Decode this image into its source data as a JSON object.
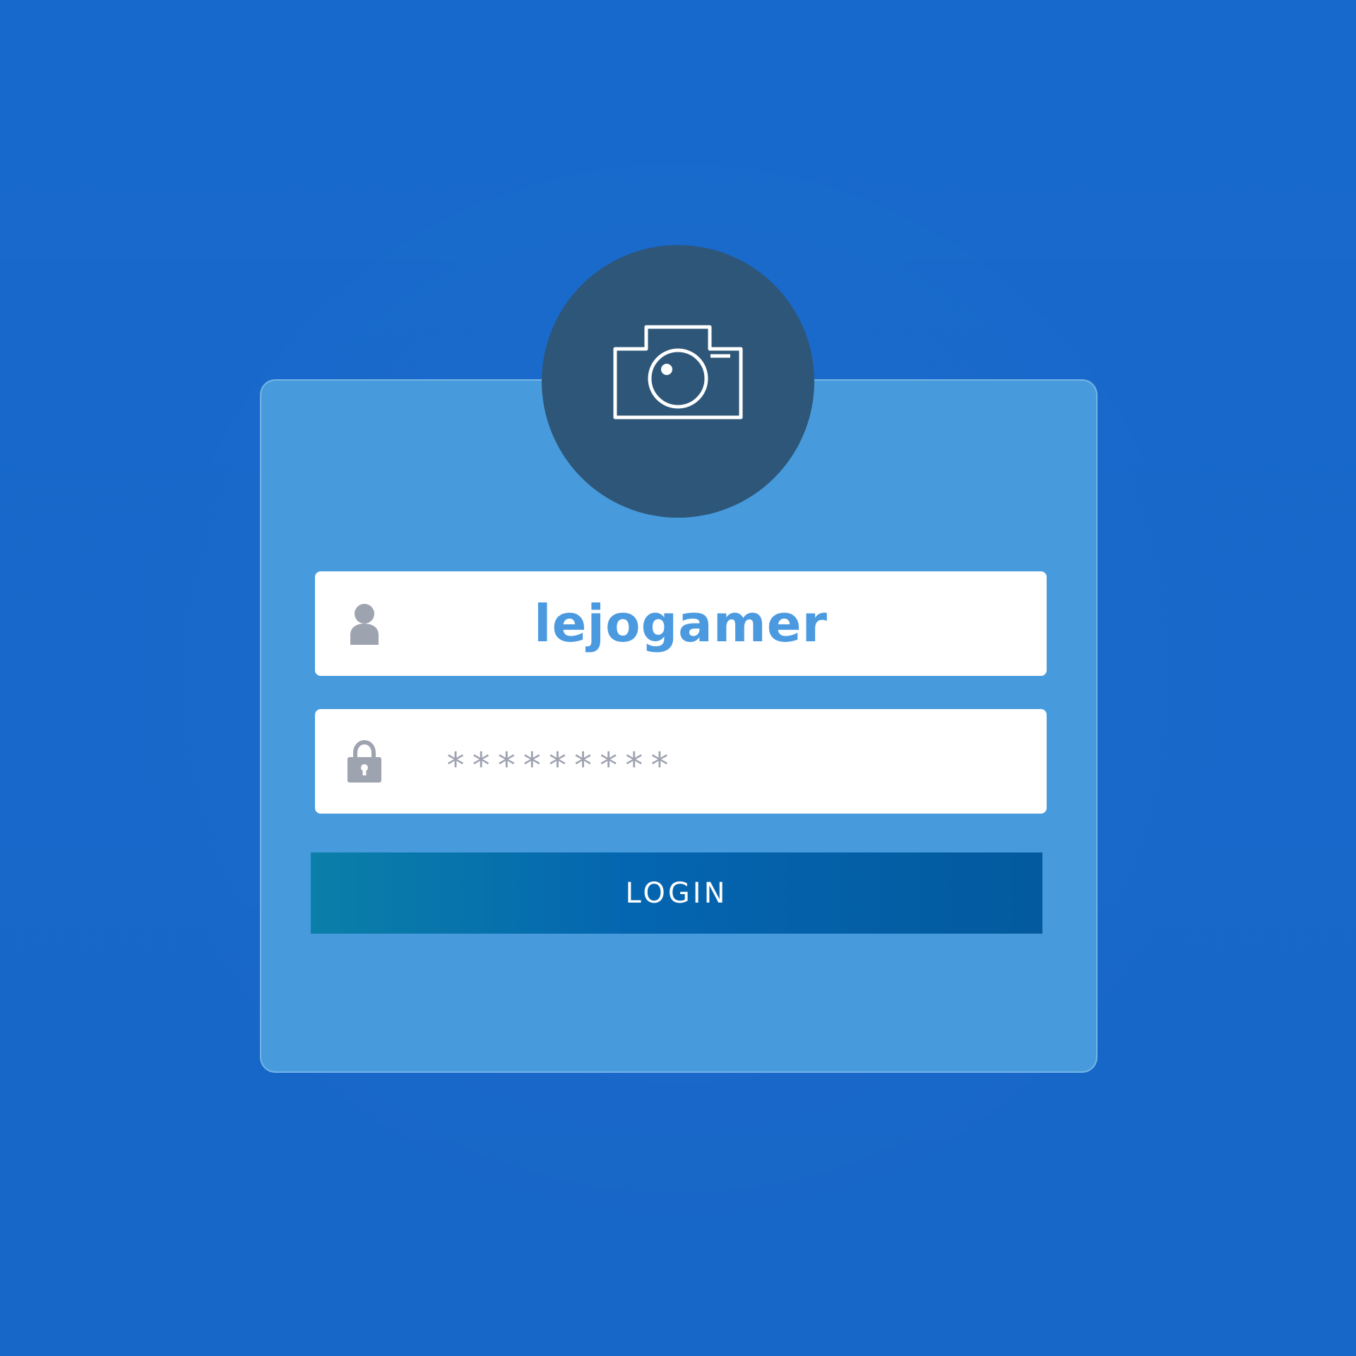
{
  "login_form": {
    "avatar_icon": "camera-icon",
    "username": {
      "icon": "user-icon",
      "value": "lejogamer"
    },
    "password": {
      "icon": "lock-icon",
      "masked_value": "*********"
    },
    "login_button_label": "LOGIN"
  },
  "colors": {
    "background": "#186bd0",
    "card": "#479bdc",
    "avatar_circle": "#2e5678",
    "username_text": "#4b9ae0",
    "icon_gray": "#9ea3b0",
    "button_gradient_start": "#0a7fa8",
    "button_gradient_end": "#035a9e"
  }
}
